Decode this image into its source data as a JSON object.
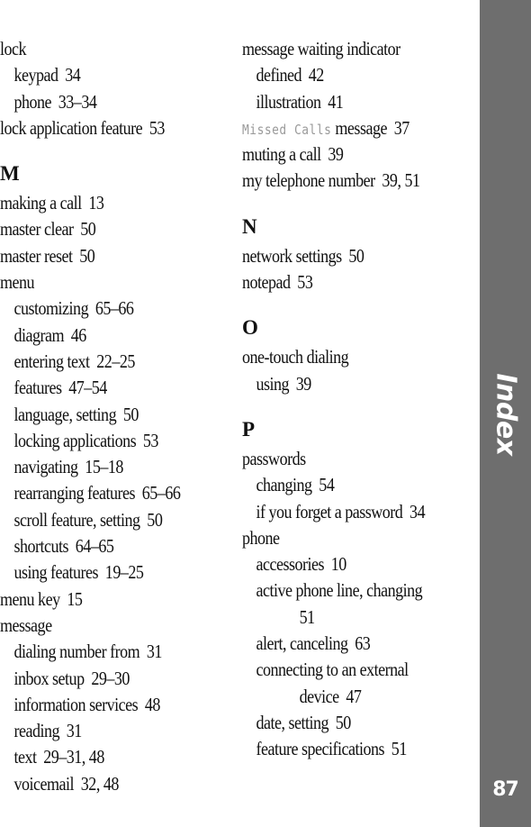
{
  "section_tab": {
    "label": "Index",
    "color": "#6e6e6e"
  },
  "page_number": "87",
  "left_column": [
    {
      "type": "main",
      "term": "lock",
      "pages": ""
    },
    {
      "type": "sub",
      "term": "keypad",
      "pages": "34"
    },
    {
      "type": "sub",
      "term": "phone",
      "pages": "33–34"
    },
    {
      "type": "main",
      "term": "lock application feature",
      "pages": "53"
    },
    {
      "type": "letter",
      "term": "M"
    },
    {
      "type": "main",
      "term": "making a call",
      "pages": "13"
    },
    {
      "type": "main",
      "term": "master clear",
      "pages": "50"
    },
    {
      "type": "main",
      "term": "master reset",
      "pages": "50"
    },
    {
      "type": "main",
      "term": "menu",
      "pages": ""
    },
    {
      "type": "sub",
      "term": "customizing",
      "pages": "65–66"
    },
    {
      "type": "sub",
      "term": "diagram",
      "pages": "46"
    },
    {
      "type": "sub",
      "term": "entering text",
      "pages": "22–25"
    },
    {
      "type": "sub",
      "term": "features",
      "pages": "47–54"
    },
    {
      "type": "sub",
      "term": "language, setting",
      "pages": "50"
    },
    {
      "type": "sub",
      "term": "locking applications",
      "pages": "53"
    },
    {
      "type": "sub",
      "term": "navigating",
      "pages": "15–18"
    },
    {
      "type": "sub",
      "term": "rearranging features",
      "pages": "65–66"
    },
    {
      "type": "sub",
      "term": "scroll feature, setting",
      "pages": "50"
    },
    {
      "type": "sub",
      "term": "shortcuts",
      "pages": "64–65"
    },
    {
      "type": "sub",
      "term": "using features",
      "pages": "19–25"
    },
    {
      "type": "main",
      "term": "menu key",
      "pages": "15"
    },
    {
      "type": "main",
      "term": "message",
      "pages": ""
    },
    {
      "type": "sub",
      "term": "dialing number from",
      "pages": "31"
    },
    {
      "type": "sub",
      "term": "inbox setup",
      "pages": "29–30"
    },
    {
      "type": "sub",
      "term": "information services",
      "pages": "48"
    },
    {
      "type": "sub",
      "term": "reading",
      "pages": "31"
    },
    {
      "type": "sub",
      "term": "text",
      "pages": "29–31, 48"
    },
    {
      "type": "sub",
      "term": "voicemail",
      "pages": "32, 48"
    }
  ],
  "right_column": [
    {
      "type": "main",
      "term": "message waiting indicator",
      "pages": ""
    },
    {
      "type": "sub",
      "term": "defined",
      "pages": "42"
    },
    {
      "type": "sub",
      "term": "illustration",
      "pages": "41"
    },
    {
      "type": "main",
      "display_text": "Missed Calls",
      "term": "message",
      "pages": "37"
    },
    {
      "type": "main",
      "term": "muting a call",
      "pages": "39"
    },
    {
      "type": "main",
      "term": "my telephone number",
      "pages": "39, 51"
    },
    {
      "type": "letter",
      "term": "N"
    },
    {
      "type": "main",
      "term": "network settings",
      "pages": "50"
    },
    {
      "type": "main",
      "term": "notepad",
      "pages": "53"
    },
    {
      "type": "letter",
      "term": "O"
    },
    {
      "type": "main",
      "term": "one-touch dialing",
      "pages": ""
    },
    {
      "type": "sub",
      "term": "using",
      "pages": "39"
    },
    {
      "type": "letter",
      "term": "P"
    },
    {
      "type": "main",
      "term": "passwords",
      "pages": ""
    },
    {
      "type": "sub",
      "term": "changing",
      "pages": "54"
    },
    {
      "type": "sub",
      "term": "if you forget a password",
      "pages": "34"
    },
    {
      "type": "main",
      "term": "phone",
      "pages": ""
    },
    {
      "type": "sub",
      "term": "accessories",
      "pages": "10"
    },
    {
      "type": "sub",
      "term": "active phone line, changing",
      "pages": ""
    },
    {
      "type": "cont",
      "term": "",
      "pages": "51"
    },
    {
      "type": "sub",
      "term": "alert, canceling",
      "pages": "63"
    },
    {
      "type": "sub",
      "term": "connecting to an external",
      "pages": ""
    },
    {
      "type": "cont",
      "term": "device",
      "pages": "47"
    },
    {
      "type": "sub",
      "term": "date, setting",
      "pages": "50"
    },
    {
      "type": "sub",
      "term": "feature specifications",
      "pages": "51"
    }
  ]
}
